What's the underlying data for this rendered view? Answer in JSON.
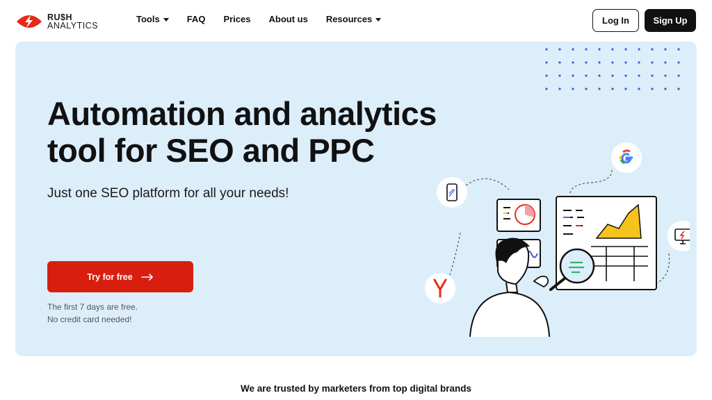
{
  "brand": {
    "line1": "RU$H",
    "line2": "ANALYTICS",
    "accent": "#e8291a"
  },
  "nav": {
    "tools": "Tools",
    "faq": "FAQ",
    "prices": "Prices",
    "about": "About us",
    "resources": "Resources"
  },
  "header": {
    "login": "Log In",
    "signup": "Sign Up"
  },
  "hero": {
    "title_line1": "Automation and analytics",
    "title_line2": "tool for SEO and PPC",
    "subtitle": "Just one SEO platform for all your needs!",
    "cta": "Try for free",
    "note_line1": "The first 7 days are free.",
    "note_line2": "No credit card needed!",
    "background": "#ddeefb",
    "cta_color": "#d81f0f"
  },
  "trusted": "We are trusted by marketers from top digital brands",
  "icons": [
    "bolt-logo-icon",
    "arrow-right-icon",
    "google-icon",
    "yandex-icon",
    "phone-icon",
    "monitor-icon"
  ]
}
